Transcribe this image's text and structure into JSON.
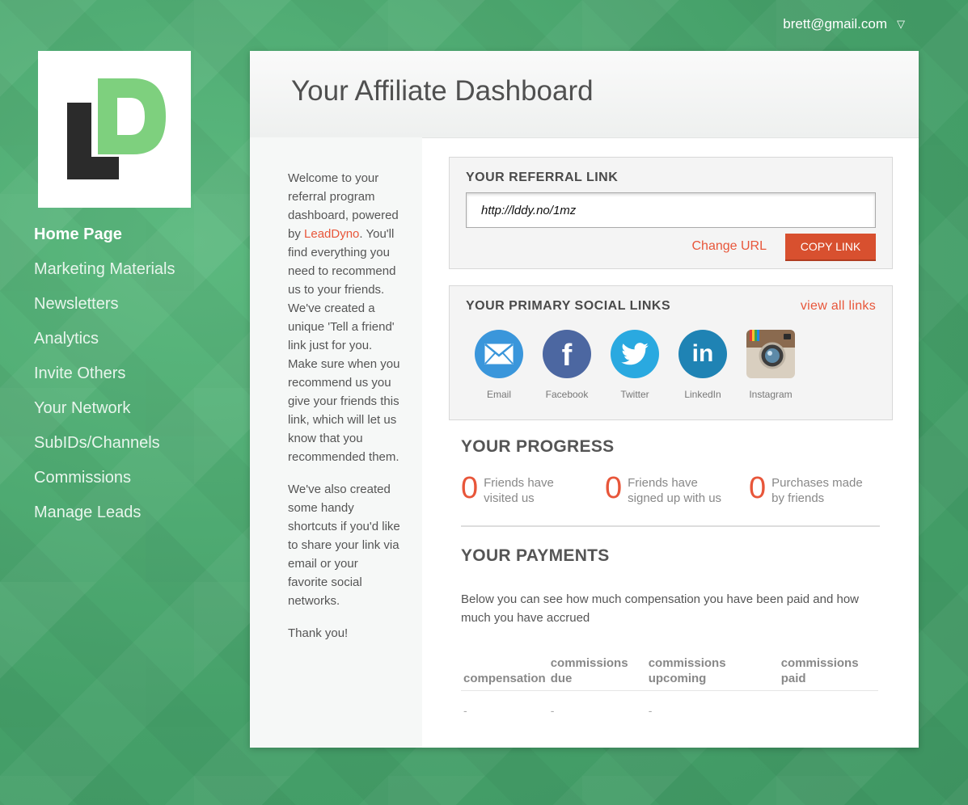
{
  "user": {
    "email": "brett@gmail.com",
    "caret_icon": "chevron-down-icon"
  },
  "logo": {
    "letters": "LD",
    "dark_color": "#2b2b2b",
    "green_color": "#7ed07e"
  },
  "nav": {
    "items": [
      {
        "label": "Home Page",
        "active": true
      },
      {
        "label": "Marketing Materials"
      },
      {
        "label": "Newsletters"
      },
      {
        "label": "Analytics"
      },
      {
        "label": "Invite Others"
      },
      {
        "label": "Your Network"
      },
      {
        "label": "SubIDs/Channels"
      },
      {
        "label": "Commissions"
      },
      {
        "label": "Manage Leads"
      }
    ]
  },
  "header": {
    "title": "Your Affiliate Dashboard"
  },
  "intro": {
    "p1_before": "Welcome to your referral program dashboard, powered by ",
    "brand": "LeadDyno",
    "p1_after": ". You'll find everything you need to recommend us to your friends. We've created a unique 'Tell a friend' link just for you. Make sure when you recommend us you give your friends this link, which will let us know that you recommended them.",
    "p2": "We've also created some handy shortcuts if you'd like to share your link via email or your favorite social networks.",
    "p3": "Thank you!"
  },
  "referral": {
    "title": "YOUR REFERRAL LINK",
    "link": "http://lddy.no/1mz",
    "change_url": "Change URL",
    "copy_link": "COPY LINK"
  },
  "social": {
    "title": "YOUR PRIMARY SOCIAL LINKS",
    "view_all": "view all links",
    "items": [
      {
        "label": "Email",
        "icon": "email-icon",
        "color": "#3a96db"
      },
      {
        "label": "Facebook",
        "icon": "facebook-icon",
        "color": "#4c67a1"
      },
      {
        "label": "Twitter",
        "icon": "twitter-icon",
        "color": "#2aa9e0"
      },
      {
        "label": "LinkedIn",
        "icon": "linkedin-icon",
        "color": "#1f83b4"
      },
      {
        "label": "Instagram",
        "icon": "instagram-icon",
        "color": "#8a6a4f"
      }
    ]
  },
  "progress": {
    "title": "YOUR PROGRESS",
    "stats": [
      {
        "value": "0",
        "line1": "Friends have",
        "line2": "visited us"
      },
      {
        "value": "0",
        "line1": "Friends have",
        "line2": "signed up with us"
      },
      {
        "value": "0",
        "line1": "Purchases made",
        "line2": "by friends"
      }
    ]
  },
  "payments": {
    "title": "YOUR PAYMENTS",
    "description": "Below you can see how much compensation you have been paid and how much you have accrued",
    "columns": [
      "compensation",
      "commissions due",
      "commissions upcoming",
      "commissions paid"
    ],
    "row": [
      "-",
      "-",
      "-",
      ""
    ]
  },
  "colors": {
    "accent": "#e8563a",
    "background": "#4aa56f"
  }
}
